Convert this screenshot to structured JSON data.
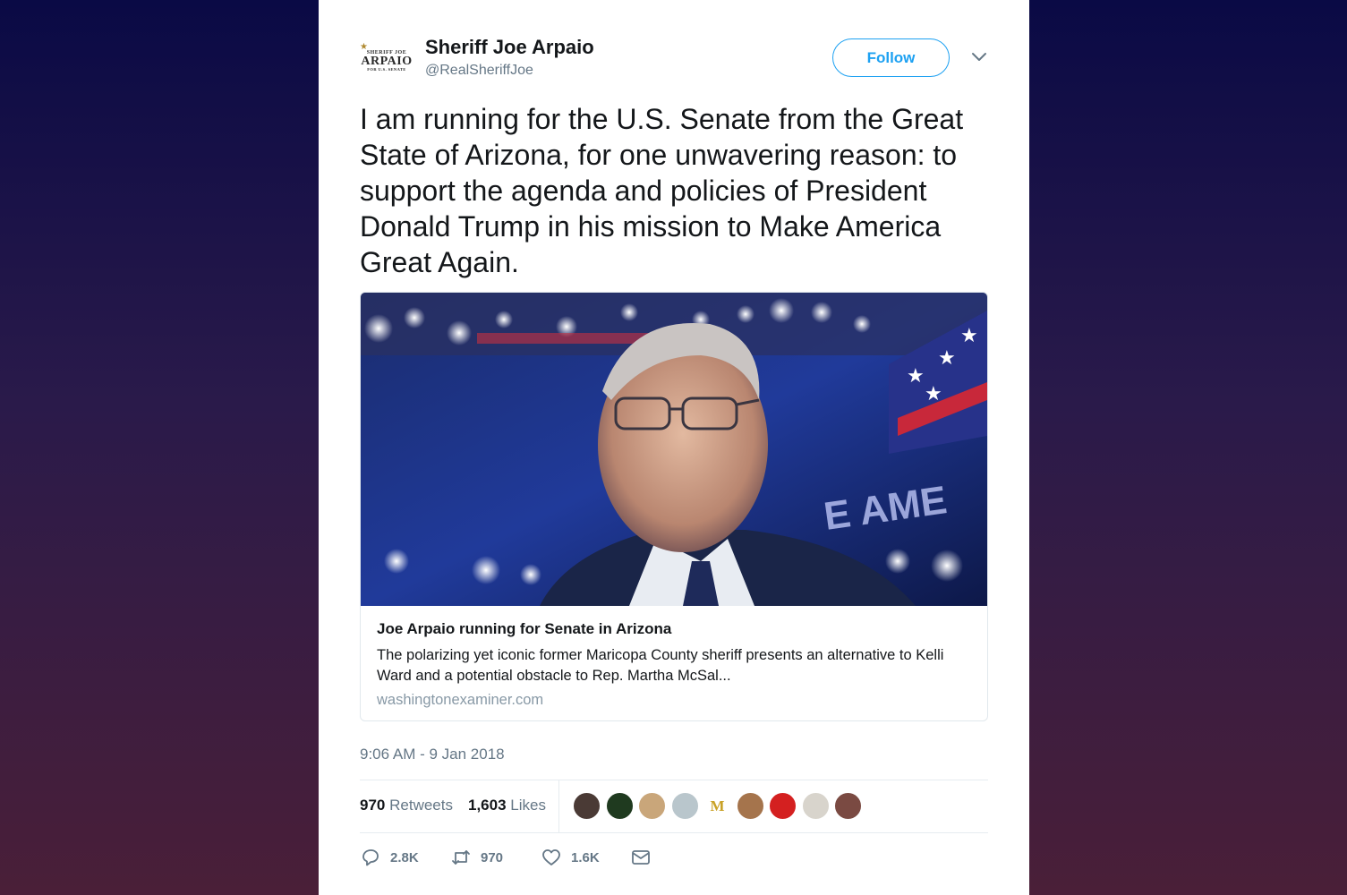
{
  "tweet": {
    "author": {
      "name": "Sheriff Joe Arpaio",
      "handle": "@RealSheriffJoe",
      "avatar_lines": [
        "SHERIFF JOE",
        "ARPAIO",
        "FOR U.S. SENATE"
      ]
    },
    "follow_label": "Follow",
    "text": "I am running for the U.S. Senate from the Great State of Arizona, for one unwavering reason: to support the agenda and policies of President Donald Trump in his mission to Make America Great Again.",
    "link_card": {
      "title": "Joe Arpaio running for Senate in Arizona",
      "description": "The polarizing yet iconic former Maricopa County sheriff presents an alternative to Kelli Ward and a potential obstacle to Rep. Martha McSal...",
      "domain": "washingtonexaminer.com",
      "image_overlay_text": "E AME"
    },
    "timestamp": "9:06 AM - 9 Jan 2018",
    "stats": {
      "retweets_count": "970",
      "retweets_label": "Retweets",
      "likes_count": "1,603",
      "likes_label": "Likes"
    },
    "liker_avatars": [
      {
        "color": "#4a3a35",
        "glyph": ""
      },
      {
        "color": "#1f3a1f",
        "glyph": ""
      },
      {
        "color": "#c9a67a",
        "glyph": ""
      },
      {
        "color": "#b9c6cc",
        "glyph": ""
      },
      {
        "color": "#ffffff",
        "glyph": "M",
        "glyph_color": "#c9a227"
      },
      {
        "color": "#a5744c",
        "glyph": ""
      },
      {
        "color": "#d42020",
        "glyph": ""
      },
      {
        "color": "#d8d4cc",
        "glyph": ""
      },
      {
        "color": "#7a4a42",
        "glyph": ""
      }
    ],
    "actions": {
      "replies": "2.8K",
      "retweets": "970",
      "likes": "1.6K"
    }
  },
  "colors": {
    "accent": "#1da1f2",
    "secondary_text": "#657786",
    "primary_text": "#14171a"
  }
}
